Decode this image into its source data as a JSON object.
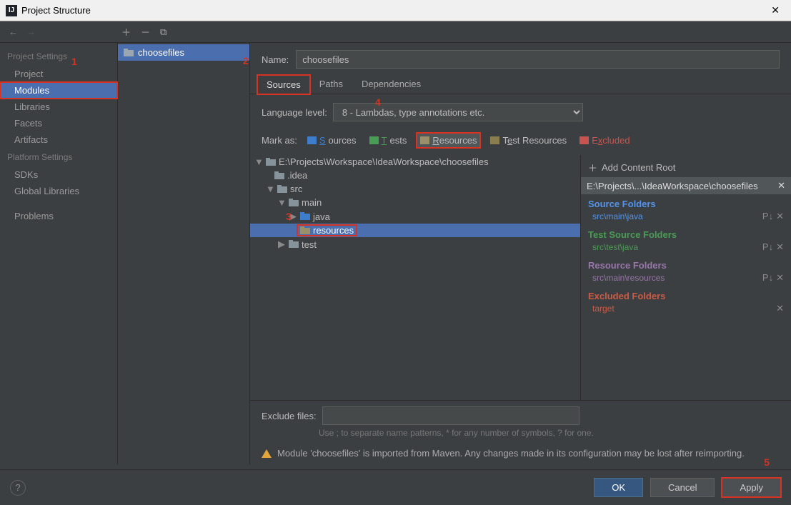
{
  "title": "Project Structure",
  "sidebar": {
    "projectSettings": "Project Settings",
    "items": [
      "Project",
      "Modules",
      "Libraries",
      "Facets",
      "Artifacts"
    ],
    "platformSettings": "Platform Settings",
    "platformItems": [
      "SDKs",
      "Global Libraries"
    ],
    "problems": "Problems"
  },
  "moduleList": {
    "module": "choosefiles"
  },
  "nameLabel": "Name:",
  "nameValue": "choosefiles",
  "tabs": [
    "Sources",
    "Paths",
    "Dependencies"
  ],
  "langLabel": "Language level:",
  "langValue": "8 - Lambdas, type annotations etc.",
  "markAsLabel": "Mark as:",
  "marks": {
    "sources": "Sources",
    "tests": "Tests",
    "resources": "Resources",
    "testResources": "Test Resources",
    "excluded": "Excluded"
  },
  "markColors": {
    "sources": "#3d7dcc",
    "tests": "#499c54",
    "resources": "#9a8f6b",
    "testResources": "#8a7d4e",
    "excluded": "#c75450"
  },
  "tree": {
    "root": "E:\\Projects\\Workspace\\IdeaWorkspace\\choosefiles",
    "idea": ".idea",
    "src": "src",
    "main": "main",
    "java": "java",
    "resources": "resources",
    "test": "test"
  },
  "contentRoot": {
    "addLabel": "Add Content Root",
    "path": "E:\\Projects\\...\\IdeaWorkspace\\choosefiles",
    "sourceFolders": "Source Folders",
    "sourceEntry": "src\\main\\java",
    "testSourceFolders": "Test Source Folders",
    "testEntry": "src\\test\\java",
    "resourceFolders": "Resource Folders",
    "resourceEntry": "src\\main\\resources",
    "excludedFolders": "Excluded Folders",
    "excludedEntry": "target"
  },
  "excludeLabel": "Exclude files:",
  "excludeHint": "Use ; to separate name patterns, * for any number of symbols, ? for one.",
  "warning": "Module 'choosefiles' is imported from Maven. Any changes made in its configuration may be lost after reimporting.",
  "buttons": {
    "ok": "OK",
    "cancel": "Cancel",
    "apply": "Apply"
  },
  "annotations": {
    "n1": "1",
    "n2": "2",
    "n3": "3",
    "n4": "4",
    "n5": "5"
  }
}
